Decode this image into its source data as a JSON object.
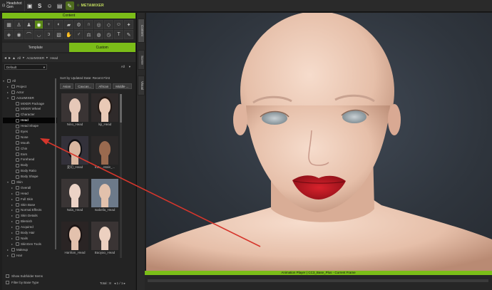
{
  "topbar": {
    "buttons": [
      {
        "icon": "headshot-icon",
        "label": "Headshot\nGen"
      },
      {
        "icon": "folder-icon",
        "label": ""
      },
      {
        "icon": "bold-s-icon",
        "label": "S"
      },
      {
        "icon": "face-icon",
        "label": ""
      },
      {
        "icon": "photo-icon",
        "label": ""
      },
      {
        "icon": "brush-icon",
        "label": ""
      },
      {
        "icon": "mixer-logo",
        "label": "METAMIXER"
      }
    ]
  },
  "content": {
    "header": "Content",
    "tabs": [
      "Template",
      "Custom"
    ],
    "active_tab": "Custom",
    "breadcrumb": [
      "All",
      "ActorMIXER",
      "Head"
    ],
    "filter_select": "Default",
    "filter_right": "All",
    "sort_label": "Sort by Updated Date: Recent First",
    "chips": [
      "Asian",
      "Caucas...",
      "African",
      "Middle ..."
    ],
    "tree": [
      {
        "label": "All",
        "level": 0,
        "twisty": "▾"
      },
      {
        "label": "Project",
        "level": 1,
        "twisty": "▸"
      },
      {
        "label": "Actor",
        "level": 1,
        "twisty": "▸"
      },
      {
        "label": "ActorMIXER",
        "level": 1,
        "twisty": "▾"
      },
      {
        "label": "MIXER Package",
        "level": 2,
        "twisty": ""
      },
      {
        "label": "MIXER Wheel",
        "level": 2,
        "twisty": ""
      },
      {
        "label": "Character",
        "level": 2,
        "twisty": ""
      },
      {
        "label": "Head",
        "level": 2,
        "twisty": "",
        "selected": true
      },
      {
        "label": "Head Shape",
        "level": 2,
        "twisty": ""
      },
      {
        "label": "Eyes",
        "level": 2,
        "twisty": ""
      },
      {
        "label": "Nose",
        "level": 2,
        "twisty": ""
      },
      {
        "label": "Mouth",
        "level": 2,
        "twisty": ""
      },
      {
        "label": "Chin",
        "level": 2,
        "twisty": ""
      },
      {
        "label": "Ears",
        "level": 2,
        "twisty": ""
      },
      {
        "label": "Forehead",
        "level": 2,
        "twisty": ""
      },
      {
        "label": "Body",
        "level": 2,
        "twisty": ""
      },
      {
        "label": "Body Ratio",
        "level": 2,
        "twisty": ""
      },
      {
        "label": "Body Shape",
        "level": 2,
        "twisty": ""
      },
      {
        "label": "Skin",
        "level": 1,
        "twisty": "▾"
      },
      {
        "label": "Overall",
        "level": 2,
        "twisty": "▸"
      },
      {
        "label": "Head",
        "level": 2,
        "twisty": "▸"
      },
      {
        "label": "Full Skin",
        "level": 2,
        "twisty": "▸"
      },
      {
        "label": "Skin Base",
        "level": 2,
        "twisty": "▸"
      },
      {
        "label": "Normal Effects",
        "level": 2,
        "twisty": "▸"
      },
      {
        "label": "Skin Details",
        "level": 2,
        "twisty": "▸"
      },
      {
        "label": "Blemish",
        "level": 2,
        "twisty": "▸"
      },
      {
        "label": "Acquired",
        "level": 2,
        "twisty": "▸"
      },
      {
        "label": "Body Hair",
        "level": 2,
        "twisty": "▸"
      },
      {
        "label": "Nails",
        "level": 2,
        "twisty": "▸"
      },
      {
        "label": "SkinGen Tools",
        "level": 2,
        "twisty": "▸"
      },
      {
        "label": "Makeup",
        "level": 1,
        "twisty": "▸"
      },
      {
        "label": "Hair",
        "level": 1,
        "twisty": "▸"
      }
    ],
    "thumbnails": [
      {
        "label": "Nino_Head",
        "skin": "#e6c8b8",
        "bg": "#3a3434",
        "hair": "#3a3434"
      },
      {
        "label": "lsji_Head",
        "skin": "#e9c9b6",
        "bg": "#2f2a2a",
        "hair": "#241a16"
      },
      {
        "label": "変幻_Head",
        "skin": "#d9b7a0",
        "bg": "#33313a",
        "hair": "#111114"
      },
      {
        "label": "611-...Male_...",
        "skin": "#9a6a4f",
        "bg": "#2b2828",
        "hair": "#2b2828"
      },
      {
        "label": "Nala_Head",
        "skin": "#ecd3c6",
        "bg": "#3a3535",
        "hair": "#3a3535"
      },
      {
        "label": "Isabella_Head",
        "skin": "#e2c1ac",
        "bg": "#6d7a8a",
        "hair": "#6d7a8a"
      },
      {
        "label": "Hanhan_Head",
        "skin": "#e3c1ad",
        "bg": "#2a2424",
        "hair": "#1b1414"
      },
      {
        "label": "Baoyao_Head",
        "skin": "#ecd0c0",
        "bg": "#3a3434",
        "hair": "#3a3434"
      }
    ],
    "options": [
      "Show Subfolder Items",
      "Filter by Base Type"
    ],
    "total": "Total : 8",
    "pager": "1 / 1"
  },
  "side_tabs": [
    "Content",
    "Scene",
    "Visual"
  ],
  "animation_player": "Animation Player ( CC3_Base_Plus - Current Frame",
  "icon_grid": [
    [
      "cube-icon",
      "person-icon",
      "figure-icon",
      "head-icon",
      "dress-icon",
      "accessory-icon",
      "shoe-icon",
      "gear-icon",
      "nose-icon",
      "target-icon",
      "diamond-icon",
      "face-icon",
      "pose-icon"
    ],
    [
      "morph-icon",
      "eye-icon",
      "brow-icon",
      "mouth-icon",
      "ear-icon",
      "skin-icon",
      "hand-icon",
      "body-icon",
      "scale-icon",
      "palette-icon",
      "clock-icon",
      "text-icon",
      "brush-icon"
    ]
  ],
  "colors": {
    "accent": "#7bbd18",
    "arrow": "#d6362c"
  }
}
